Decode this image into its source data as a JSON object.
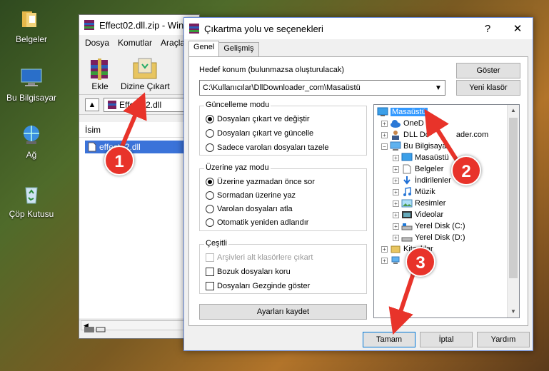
{
  "desktop": {
    "icons": [
      {
        "label": "Belgeler"
      },
      {
        "label": "Bu Bilgisayar"
      },
      {
        "label": "Ağ"
      },
      {
        "label": "Çöp Kutusu"
      }
    ]
  },
  "winrar": {
    "title": "Effect02.dll.zip - Win",
    "menu": [
      "Dosya",
      "Komutlar",
      "Araçla"
    ],
    "tools": [
      "Ekle",
      "Dizine Çıkart"
    ],
    "path": "Effect02.dll",
    "column": "İsim",
    "file": "effect02.dll"
  },
  "dialog": {
    "title": "Çıkartma yolu ve seçenekleri",
    "help_glyph": "?",
    "close_glyph": "✕",
    "tabs": [
      "Genel",
      "Gelişmiş"
    ],
    "dest_label": "Hedef konum (bulunmazsa oluşturulacak)",
    "dest_value": "C:\\Kullanıcılar\\DllDownloader_com\\Masaüstü",
    "show_btn": "Göster",
    "new_folder_btn": "Yeni klasör",
    "update_mode": {
      "title": "Güncelleme modu",
      "options": [
        "Dosyaları çıkart ve değiştir",
        "Dosyaları çıkart ve güncelle",
        "Sadece varolan dosyaları tazele"
      ],
      "selected": 0
    },
    "overwrite_mode": {
      "title": "Üzerine yaz modu",
      "options": [
        "Üzerine yazmadan önce sor",
        "Sormadan üzerine yaz",
        "Varolan dosyaları atla",
        "Otomatik yeniden adlandır"
      ],
      "selected": 0
    },
    "misc": {
      "title": "Çeşitli",
      "options": [
        "Arşivleri alt klasörlere çıkart",
        "Bozuk dosyaları koru",
        "Dosyaları Gezginde göster"
      ]
    },
    "save_btn": "Ayarları kaydet",
    "tree": [
      {
        "label": "Masaüstü",
        "icon": "desktop-icon"
      },
      {
        "label": "OneD",
        "icon": "cloud-icon"
      },
      {
        "label": "DLL Do",
        "label2": "ader.com",
        "icon": "user-icon"
      },
      {
        "label": "Bu Bilgisaya",
        "icon": "computer-icon"
      },
      {
        "label": "Masaüstü",
        "icon": "desktop-icon"
      },
      {
        "label": "Belgeler",
        "icon": "document-icon"
      },
      {
        "label": "İndirilenler",
        "icon": "download-icon"
      },
      {
        "label": "Müzik",
        "icon": "music-icon"
      },
      {
        "label": "Resimler",
        "icon": "picture-icon"
      },
      {
        "label": "Videolar",
        "icon": "video-icon"
      },
      {
        "label": "Yerel Disk (C:)",
        "icon": "drive-icon"
      },
      {
        "label": "Yerel Disk (D:)",
        "icon": "drive-icon"
      },
      {
        "label": "Kita",
        "label2": "klar",
        "icon": "library-icon"
      }
    ],
    "ok_btn": "Tamam",
    "cancel_btn": "İptal",
    "help_btn": "Yardım"
  },
  "annotations": {
    "badges": [
      "1",
      "2",
      "3"
    ],
    "color": "#e8332a"
  }
}
